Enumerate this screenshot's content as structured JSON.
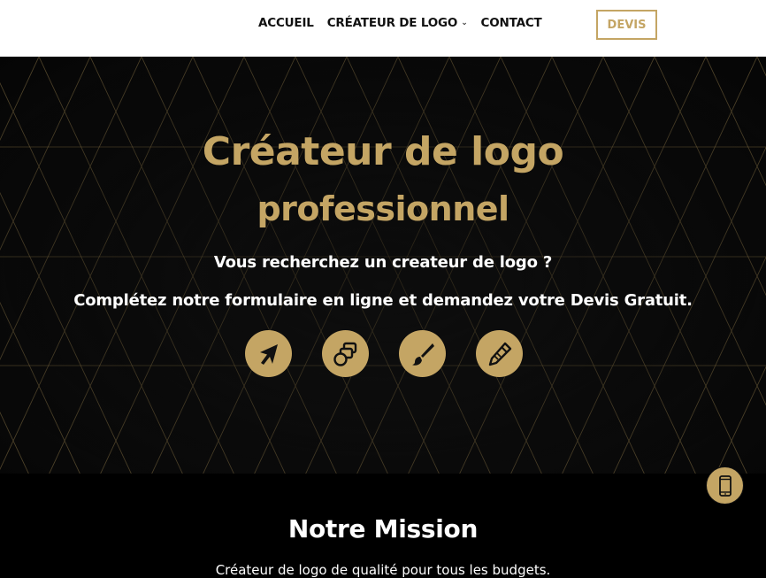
{
  "nav": {
    "items": [
      {
        "label": "ACCUEIL",
        "has_dropdown": false
      },
      {
        "label": "CRÉATEUR DE LOGO",
        "has_dropdown": true
      },
      {
        "label": "CONTACT",
        "has_dropdown": false
      }
    ],
    "cta_label": "DEVIS"
  },
  "hero": {
    "title_line1": "Créateur de logo",
    "title_line2": "professionnel",
    "subtitle1": "Vous recherchez un createur de logo ?",
    "subtitle2": "Complétez notre formulaire en ligne et demandez votre Devis Gratuit.",
    "icons": [
      "cursor-arrow-icon",
      "layers-icon",
      "paintbrush-icon",
      "pencil-icon"
    ]
  },
  "mission": {
    "title": "Notre Mission",
    "text": "Créateur de logo de qualité pour tous les budgets."
  },
  "floating": {
    "icon": "smartphone-icon"
  },
  "colors": {
    "gold": "#c4a564",
    "dark": "#0c0c0c",
    "white": "#ffffff"
  }
}
